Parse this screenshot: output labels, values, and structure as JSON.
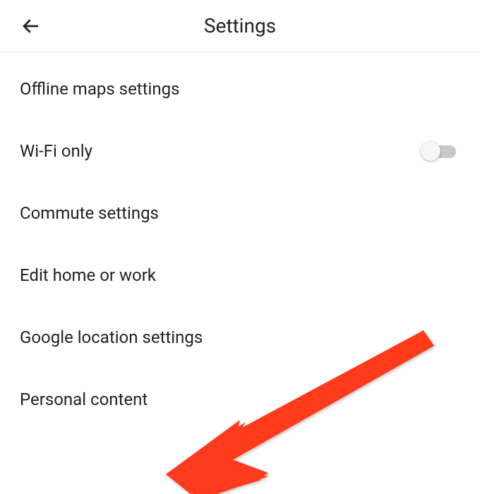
{
  "header": {
    "title": "Settings"
  },
  "settings": {
    "items": [
      {
        "label": "Offline maps settings",
        "has_toggle": false
      },
      {
        "label": "Wi-Fi only",
        "has_toggle": true,
        "toggle_on": false
      },
      {
        "label": "Commute settings",
        "has_toggle": false
      },
      {
        "label": "Edit home or work",
        "has_toggle": false
      },
      {
        "label": "Google location settings",
        "has_toggle": false
      },
      {
        "label": "Personal content",
        "has_toggle": false
      }
    ]
  },
  "annotation": {
    "arrow_color": "#ff3a1f"
  }
}
